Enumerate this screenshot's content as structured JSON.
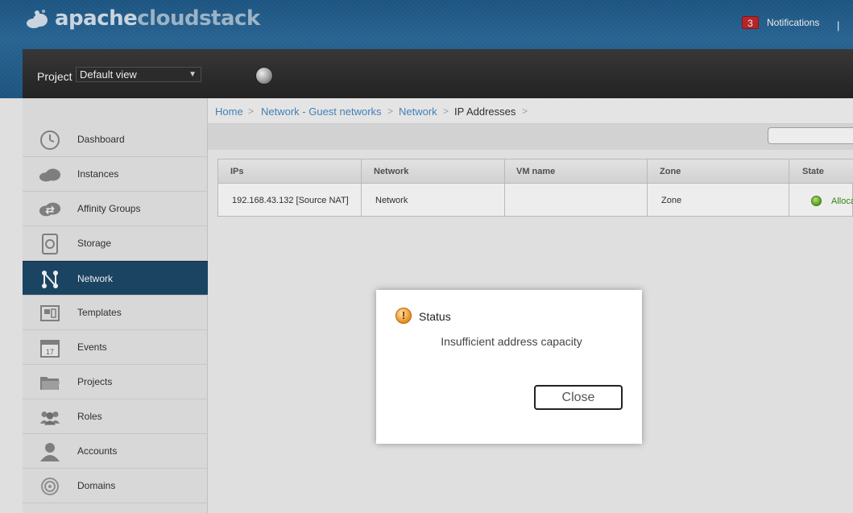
{
  "header": {
    "logo_bold": "apache",
    "logo_light": "cloudstack",
    "notifications_count": "3",
    "notifications_label": "Notifications",
    "separator": "|"
  },
  "project": {
    "label": "Project",
    "selected": "Default view"
  },
  "sidebar": {
    "items": [
      {
        "label": "Dashboard",
        "icon": "dashboard-icon"
      },
      {
        "label": "Instances",
        "icon": "cloud-icon"
      },
      {
        "label": "Affinity Groups",
        "icon": "affinity-icon"
      },
      {
        "label": "Storage",
        "icon": "disk-icon"
      },
      {
        "label": "Network",
        "icon": "network-icon",
        "active": true
      },
      {
        "label": "Templates",
        "icon": "template-icon"
      },
      {
        "label": "Events",
        "icon": "calendar-icon"
      },
      {
        "label": "Projects",
        "icon": "folder-icon"
      },
      {
        "label": "Roles",
        "icon": "roles-icon"
      },
      {
        "label": "Accounts",
        "icon": "user-icon"
      },
      {
        "label": "Domains",
        "icon": "domains-icon"
      }
    ],
    "events_day": "17"
  },
  "breadcrumb": {
    "items": [
      "Home",
      "Network - Guest networks",
      "Network",
      "IP Addresses"
    ],
    "sep": ">"
  },
  "table": {
    "columns": [
      "IPs",
      "Network",
      "VM name",
      "Zone",
      "State"
    ],
    "rows": [
      {
        "ip": "192.168.43.132 [Source NAT]",
        "network": "Network",
        "vm": "",
        "zone": "Zone",
        "state": "Alloca"
      }
    ]
  },
  "dialog": {
    "icon": "warning-icon",
    "title": "Status",
    "message": "Insufficient address capacity",
    "close_label": "Close"
  },
  "colors": {
    "header_blue": "#1e5a8a",
    "active_nav": "#1e4a6b",
    "link": "#4a8ac4",
    "state_green": "#3d8b16"
  }
}
